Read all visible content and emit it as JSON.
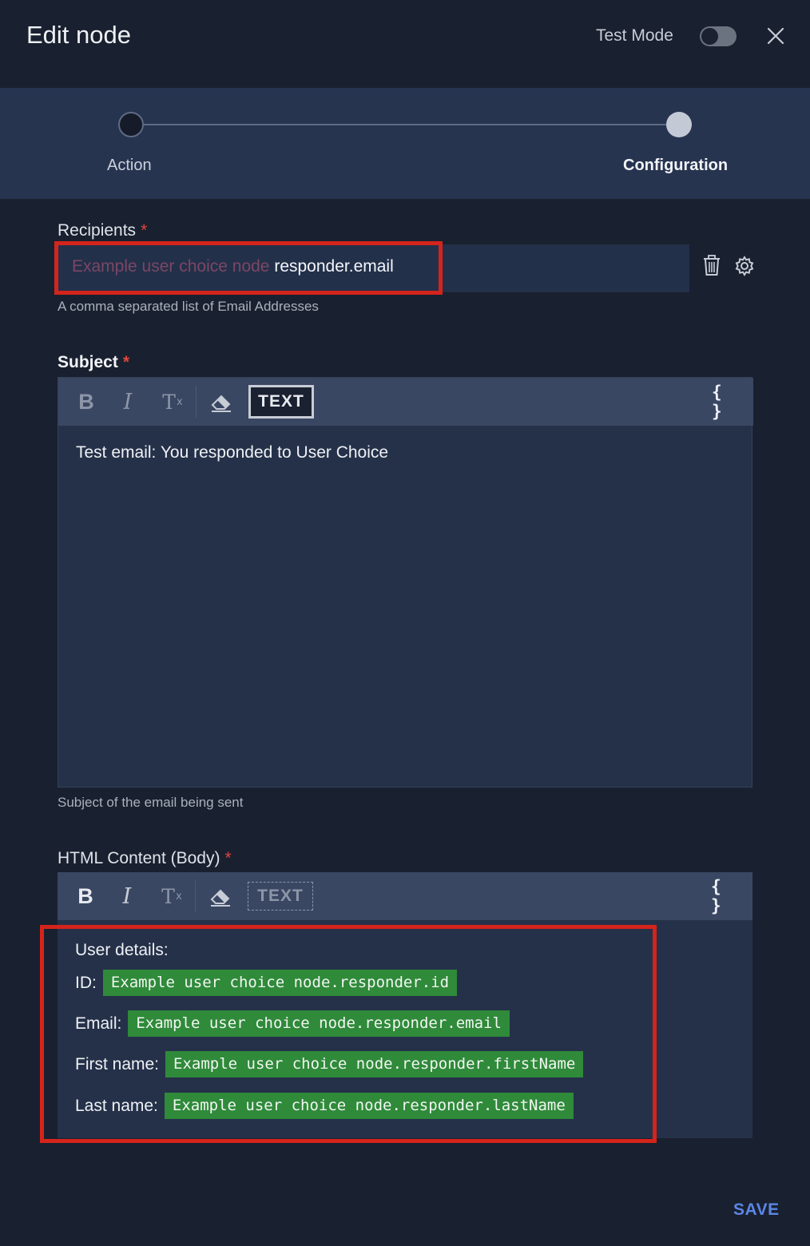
{
  "header": {
    "title": "Edit node",
    "test_mode_label": "Test Mode"
  },
  "stepper": {
    "steps": [
      {
        "label": "Action"
      },
      {
        "label": "Configuration"
      }
    ]
  },
  "recipients": {
    "label": "Recipients",
    "required_mark": "*",
    "placeholder_text": "Example user choice node",
    "value_text": "responder.email",
    "helper": "A comma separated list of Email Addresses"
  },
  "subject": {
    "label": "Subject",
    "required_mark": "*",
    "toolbar": {
      "bold": "B",
      "italic": "I",
      "clear_format": "T",
      "clear_format_sub": "x",
      "text_mode": "TEXT",
      "variables": "{ }"
    },
    "value": "Test email: You responded to User Choice",
    "helper": "Subject of the email being sent"
  },
  "body": {
    "label": "HTML Content (Body)",
    "required_mark": "*",
    "toolbar": {
      "bold": "B",
      "italic": "I",
      "clear_format": "T",
      "clear_format_sub": "x",
      "text_mode": "TEXT",
      "variables": "{ }"
    },
    "heading": "User details:",
    "lines": [
      {
        "label": "ID:",
        "variable": "Example user choice node.responder.id"
      },
      {
        "label": "Email:",
        "variable": "Example user choice node.responder.email"
      },
      {
        "label": "First name:",
        "variable": "Example user choice node.responder.firstName"
      },
      {
        "label": "Last name:",
        "variable": "Example user choice node.responder.lastName"
      }
    ]
  },
  "footer": {
    "save_label": "SAVE"
  },
  "colors": {
    "background": "#19202f",
    "stepper_bg": "#273450",
    "highlight_red": "#d4241c",
    "variable_chip": "#2f8a3a",
    "save_blue": "#5b86e6",
    "required_red": "#e0453b"
  }
}
